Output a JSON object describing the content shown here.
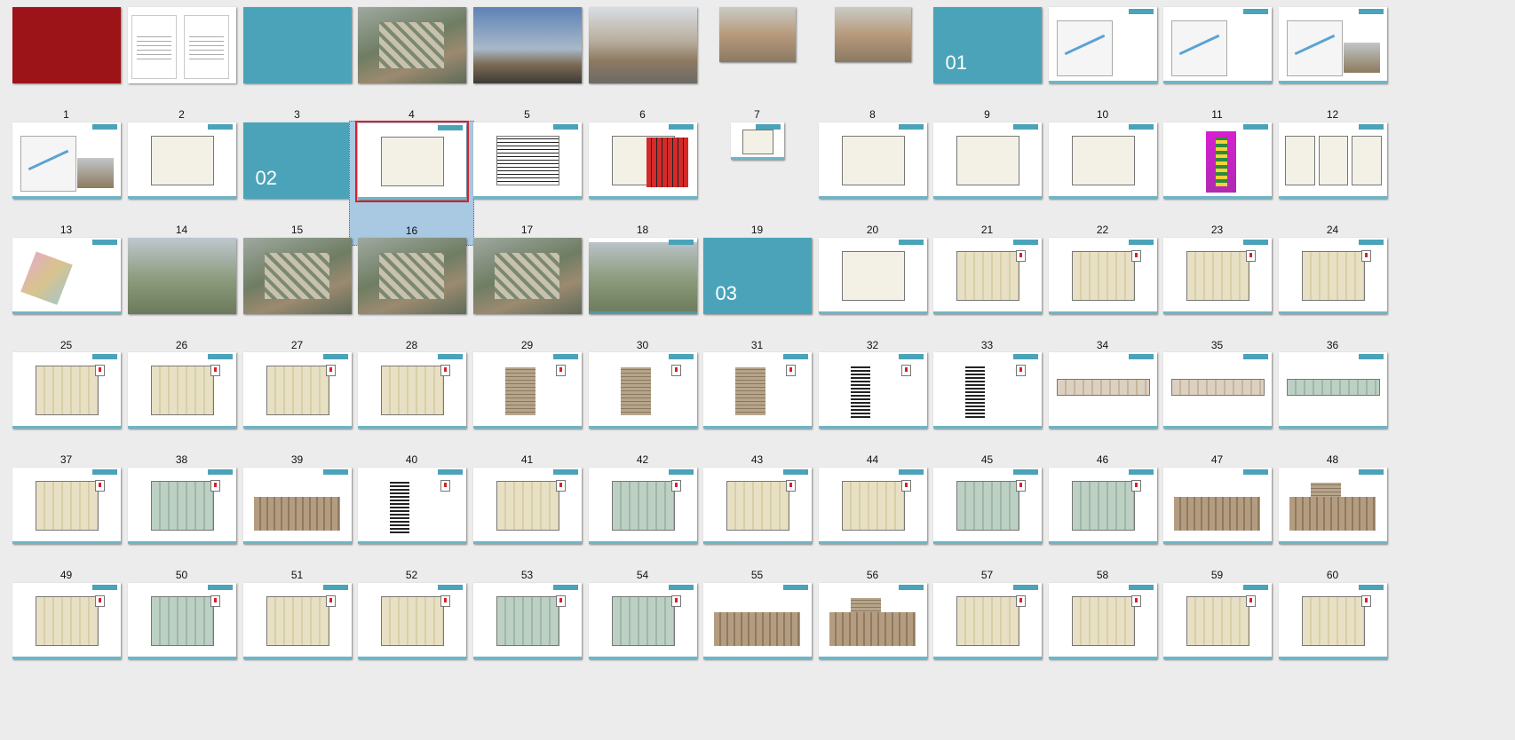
{
  "title": "",
  "selected_slide": 16,
  "slides": [
    {
      "n": "1",
      "kind": "red"
    },
    {
      "n": "2",
      "kind": "doc"
    },
    {
      "n": "3",
      "kind": "teal"
    },
    {
      "n": "4",
      "kind": "aerial"
    },
    {
      "n": "5",
      "kind": "tower-render"
    },
    {
      "n": "6",
      "kind": "street-render"
    },
    {
      "n": "7",
      "kind": "small-render"
    },
    {
      "n": "8",
      "kind": "small-render2"
    },
    {
      "n": "9",
      "kind": "section",
      "label": "01"
    },
    {
      "n": "10",
      "kind": "map"
    },
    {
      "n": "11",
      "kind": "map"
    },
    {
      "n": "12",
      "kind": "map-photo"
    },
    {
      "n": "13",
      "kind": "map-photo"
    },
    {
      "n": "14",
      "kind": "site"
    },
    {
      "n": "15",
      "kind": "section",
      "label": "02"
    },
    {
      "n": "16",
      "kind": "site-plan"
    },
    {
      "n": "17",
      "kind": "site-bw"
    },
    {
      "n": "18",
      "kind": "red-plan"
    },
    {
      "n": "19",
      "kind": "small-diagram"
    },
    {
      "n": "20",
      "kind": "site-plan"
    },
    {
      "n": "21",
      "kind": "site-plan"
    },
    {
      "n": "22",
      "kind": "site"
    },
    {
      "n": "23",
      "kind": "magenta"
    },
    {
      "n": "24",
      "kind": "plans3"
    },
    {
      "n": "25",
      "kind": "axo"
    },
    {
      "n": "26",
      "kind": "render"
    },
    {
      "n": "27",
      "kind": "aerial"
    },
    {
      "n": "28",
      "kind": "aerial"
    },
    {
      "n": "29",
      "kind": "aerial"
    },
    {
      "n": "30",
      "kind": "towers"
    },
    {
      "n": "31",
      "kind": "section",
      "label": "03"
    },
    {
      "n": "32",
      "kind": "site"
    },
    {
      "n": "33",
      "kind": "plan"
    },
    {
      "n": "34",
      "kind": "plan"
    },
    {
      "n": "35",
      "kind": "plan"
    },
    {
      "n": "36",
      "kind": "plan"
    },
    {
      "n": "37",
      "kind": "plan"
    },
    {
      "n": "38",
      "kind": "plan"
    },
    {
      "n": "39",
      "kind": "plan"
    },
    {
      "n": "40",
      "kind": "plan"
    },
    {
      "n": "41",
      "kind": "tower"
    },
    {
      "n": "42",
      "kind": "tower"
    },
    {
      "n": "43",
      "kind": "tower"
    },
    {
      "n": "44",
      "kind": "bw-tower"
    },
    {
      "n": "45",
      "kind": "bw-tower"
    },
    {
      "n": "46",
      "kind": "strip"
    },
    {
      "n": "47",
      "kind": "strip"
    },
    {
      "n": "48",
      "kind": "strip-g"
    },
    {
      "n": "49",
      "kind": "plan"
    },
    {
      "n": "50",
      "kind": "plan-g"
    },
    {
      "n": "51",
      "kind": "elev"
    },
    {
      "n": "52",
      "kind": "bw-tower"
    },
    {
      "n": "53",
      "kind": "plan"
    },
    {
      "n": "54",
      "kind": "plan-g"
    },
    {
      "n": "55",
      "kind": "plan"
    },
    {
      "n": "56",
      "kind": "plan"
    },
    {
      "n": "57",
      "kind": "plan-g"
    },
    {
      "n": "58",
      "kind": "plan-g"
    },
    {
      "n": "59",
      "kind": "elev"
    },
    {
      "n": "60",
      "kind": "elev-tower"
    },
    {
      "n": "",
      "kind": "plan"
    },
    {
      "n": "",
      "kind": "plan-g"
    },
    {
      "n": "",
      "kind": "plan"
    },
    {
      "n": "",
      "kind": "plan"
    },
    {
      "n": "",
      "kind": "plan-g"
    },
    {
      "n": "",
      "kind": "plan-g"
    },
    {
      "n": "",
      "kind": "elev"
    },
    {
      "n": "",
      "kind": "elev-tower"
    },
    {
      "n": "",
      "kind": "plan"
    },
    {
      "n": "",
      "kind": "plan"
    },
    {
      "n": "",
      "kind": "plan"
    },
    {
      "n": "",
      "kind": "plan"
    }
  ]
}
